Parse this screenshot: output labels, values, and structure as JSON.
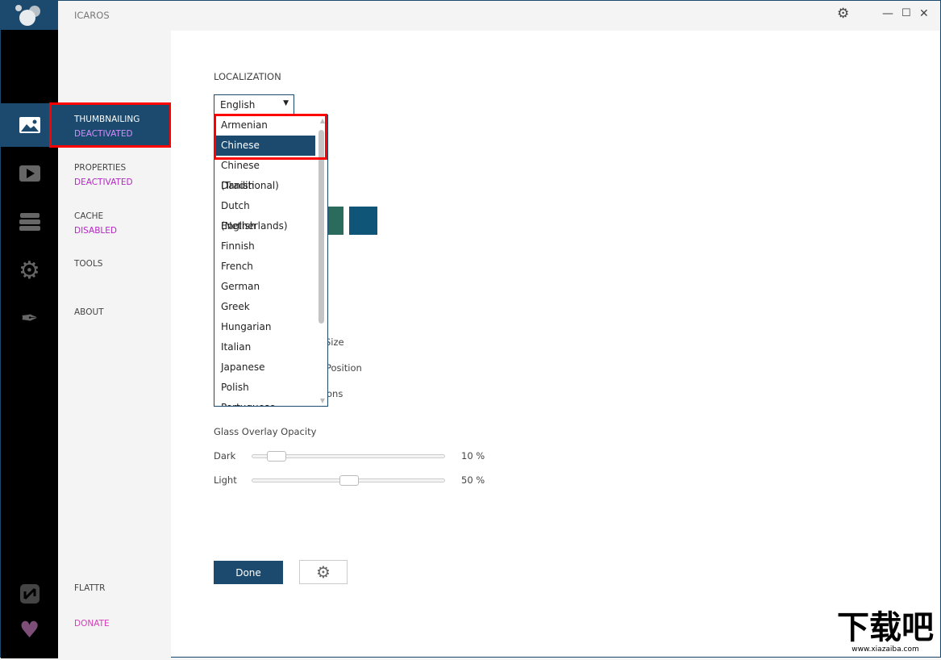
{
  "app": {
    "title": "ICAROS"
  },
  "window": {
    "settings_icon": "gear-icon",
    "minimize_icon": "minimize-icon",
    "maximize_icon": "maximize-icon",
    "close_icon": "close-icon"
  },
  "nav": [
    {
      "label": "THUMBNAILING",
      "status": "DEACTIVATED",
      "icon": "image-icon",
      "active": true
    },
    {
      "label": "PROPERTIES",
      "status": "DEACTIVATED",
      "icon": "play-icon"
    },
    {
      "label": "CACHE",
      "status": "DISABLED",
      "icon": "stack-icon"
    },
    {
      "label": "TOOLS",
      "status": "",
      "icon": "gear-wrench-icon"
    },
    {
      "label": "ABOUT",
      "status": "",
      "icon": "pen-icon"
    }
  ],
  "bottom_nav": [
    {
      "label": "FLATTR",
      "icon": "flattr-icon"
    },
    {
      "label": "DONATE",
      "icon": "heart-icon"
    }
  ],
  "main": {
    "localization_label": "LOCALIZATION",
    "language_selected": "English",
    "language_options": [
      "Armenian",
      "Chinese (Simplified)",
      "Chinese (Traditional)",
      "Danish",
      "Dutch (Netherlands)",
      "English",
      "Finnish",
      "French",
      "German",
      "Greek",
      "Hungarian",
      "Italian",
      "Japanese",
      "Polish",
      "Portuguese"
    ],
    "highlighted_option": "Chinese (Simplified)",
    "swatch_colors": [
      "#2a6b5e",
      "#0e5578"
    ],
    "partial_labels": [
      "Size",
      "Position",
      "ons"
    ],
    "glass_label": "Glass Overlay Opacity",
    "sliders": [
      {
        "label": "Dark",
        "value": 10,
        "display": "10 %"
      },
      {
        "label": "Light",
        "value": 50,
        "display": "50 %"
      }
    ],
    "done_label": "Done"
  },
  "watermark": {
    "text": "下载吧",
    "sub": "www.xiazaiba.com"
  }
}
